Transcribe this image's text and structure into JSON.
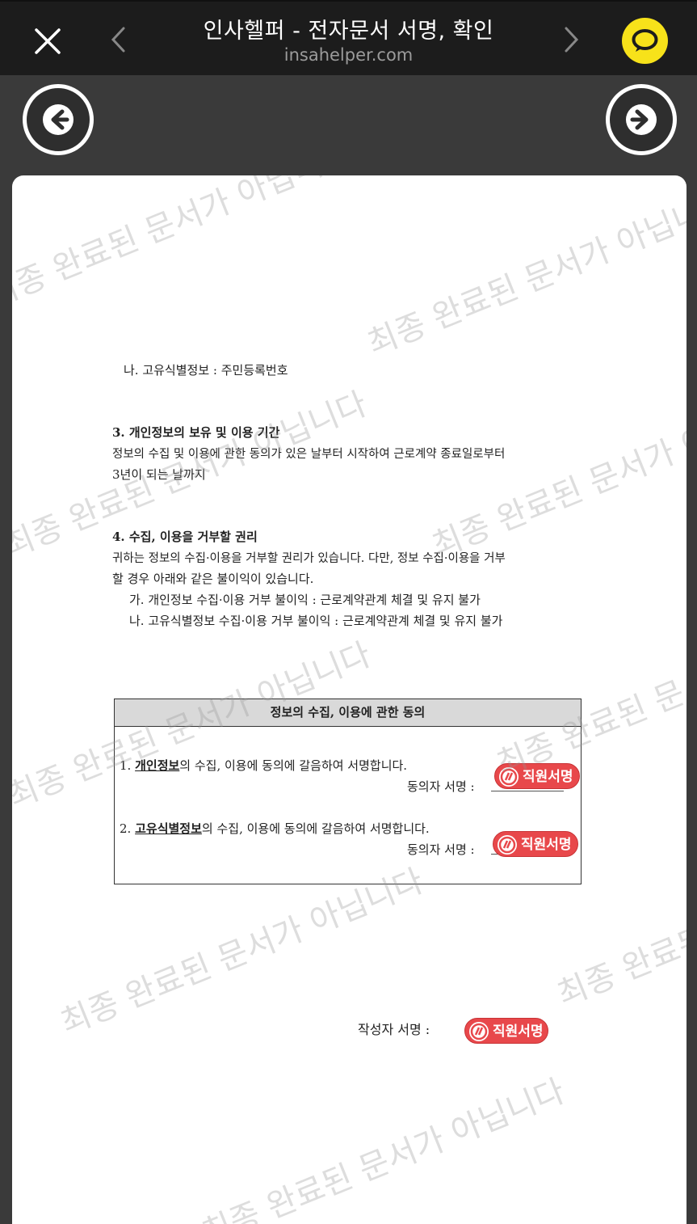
{
  "topbar": {
    "title": "인사헬퍼 - 전자문서 서명, 확인",
    "url": "insahelper.com",
    "close_icon": "close-icon",
    "back_icon": "chevron-left-icon",
    "forward_icon": "chevron-right-icon",
    "share_icon": "kakaotalk-icon",
    "share_color": "#f7e21a"
  },
  "nav": {
    "prev_icon": "arrow-left-circle-icon",
    "next_icon": "arrow-right-circle-icon"
  },
  "document": {
    "line_unique_id": "나. 고유식별정보 : 주민등록번호",
    "sec3_title": "3. 개인정보의 보유 및 이용 기간",
    "sec3_body1": "정보의 수집 및 이용에 관한 동의가 있은 날부터 시작하여 근로계약 종료일로부터",
    "sec3_body2": "3년이 되는 날까지",
    "sec4_title": "4. 수집, 이용을 거부할 권리",
    "sec4_body1": "귀하는 정보의 수집·이용을 거부할 권리가 있습니다. 다만, 정보 수집·이용을 거부",
    "sec4_body2": "할 경우 아래와 같은 불이익이 있습니다.",
    "sec4_item_a": "가. 개인정보 수집·이용 거부 불이익 : 근로계약관계 체결 및 유지 불가",
    "sec4_item_b": "나. 고유식별정보 수집·이용 거부 불이익 : 근로계약관계 체결 및 유지 불가",
    "consent": {
      "header": "정보의 수집, 이용에 관한 동의",
      "item1_prefix": "1. ",
      "item1_key": "개인정보",
      "item1_rest": "의 수집, 이용에 동의에 갈음하여 서명합니다.",
      "item2_prefix": "2. ",
      "item2_key": "고유식별정보",
      "item2_rest": "의 수집, 이용에 동의에 갈음하여 서명합니다.",
      "signer_label": "동의자 서명 :"
    },
    "author_label": "작성자 서명 :",
    "stamp_label": "직원서명",
    "stamp_color": "#e8484b"
  },
  "watermark": {
    "text_a": "최종 완료된 문서가 아닙니다",
    "text_b": "최종 완료된 문서가 아닙니다"
  }
}
